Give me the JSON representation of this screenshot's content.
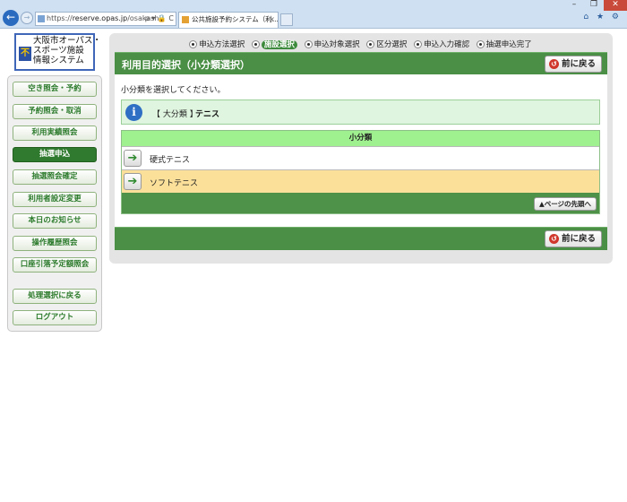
{
  "browser": {
    "url_scheme": "https://",
    "url_host": "reserve.opas.jp",
    "url_path": "/osakashi/",
    "address_tools": "ρ ▾ 🔒 C",
    "tab_title": "公共施設予約システム（利...",
    "tab_close": "×",
    "right_icons": "⌂ ★ ⚙",
    "window_controls": {
      "minimize": "–",
      "maximize": "❐",
      "close": "✕"
    }
  },
  "logo": {
    "text_line1": "大阪市オーパス・",
    "text_line2": "スポーツ施設",
    "text_line3": "情報システム"
  },
  "sidebar": {
    "items": [
      {
        "label": "空き照会・予約",
        "active": false
      },
      {
        "label": "予約照会・取消",
        "active": false
      },
      {
        "label": "利用実績照会",
        "active": false
      },
      {
        "label": "抽選申込",
        "active": true
      },
      {
        "label": "抽選照会確定",
        "active": false
      },
      {
        "label": "利用者設定変更",
        "active": false
      },
      {
        "label": "本日のお知らせ",
        "active": false
      },
      {
        "label": "操作履歴照会",
        "active": false
      },
      {
        "label": "口座引落予定額照会",
        "active": false
      }
    ],
    "bottom_items": [
      {
        "label": "処理選択に戻る"
      },
      {
        "label": "ログアウト"
      }
    ]
  },
  "steps": [
    {
      "label": "申込方法選択",
      "current": false
    },
    {
      "label": "施設選択",
      "current": true
    },
    {
      "label": "申込対象選択",
      "current": false
    },
    {
      "label": "区分選択",
      "current": false
    },
    {
      "label": "申込入力確認",
      "current": false
    },
    {
      "label": "抽選申込完了",
      "current": false
    }
  ],
  "page": {
    "title": "利用目的選択（小分類選択）",
    "back_label": "前に戻る",
    "instruction": "小分類を選択してください。",
    "category_label": "【 大分類 】",
    "category_value": "テニス",
    "table_header": "小分類",
    "options": [
      {
        "label": "硬式テニス"
      },
      {
        "label": "ソフトテニス"
      }
    ],
    "page_top_label": "▲ページの先頭へ"
  },
  "icons": {
    "back": "back-arrow-icon",
    "select_arrow": "right-arrow-icon",
    "info": "info-icon"
  },
  "colors": {
    "accent_green": "#4a8f45",
    "header_green": "#9ff08f",
    "highlight_row": "#fbe09a",
    "info_bg": "#dff5df"
  }
}
